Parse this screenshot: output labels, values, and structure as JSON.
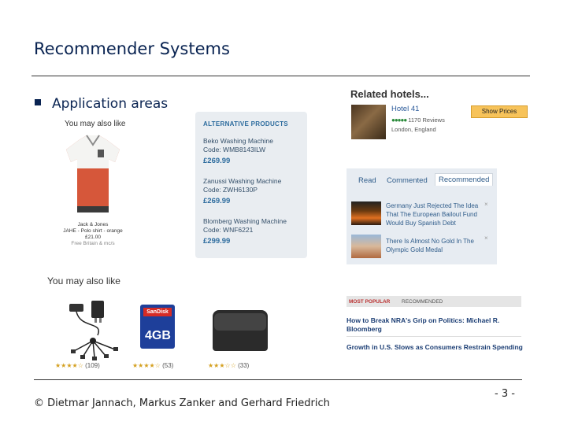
{
  "slide": {
    "title": "Recommender Systems",
    "bullet": "Application areas",
    "footer": "© Dietmar Jannach, Markus Zanker and Gerhard Friedrich",
    "page": "- 3 -"
  },
  "shop1": {
    "heading": "You may also like",
    "product_name": "Jack & Jones",
    "product_desc": "JAHE - Polo shirt - orange",
    "price": "£21.00",
    "shipping": "Free Britain & mc/s"
  },
  "alternative": {
    "heading": "ALTERNATIVE PRODUCTS",
    "items": [
      {
        "name": "Beko Washing Machine",
        "code": "Code: WMB8143ILW",
        "price": "£269.99"
      },
      {
        "name": "Zanussi Washing Machine",
        "code": "Code: ZWH6130P",
        "price": "£269.99"
      },
      {
        "name": "Blomberg Washing Machine",
        "code": "Code: WNF6221",
        "price": "£299.99"
      }
    ]
  },
  "hotels": {
    "heading": "Related hotels...",
    "name": "Hotel 41",
    "rating_dots": "●●●●●",
    "reviews": "1170 Reviews",
    "location": "London, England",
    "button": "Show Prices"
  },
  "news": {
    "tabs": [
      "Read",
      "Commented",
      "Recommended"
    ],
    "items": [
      "Germany Just Rejected The Idea That The European Bailout Fund Would Buy Spanish Debt",
      "There Is Almost No Gold In The Olympic Gold Medal"
    ],
    "close": "×"
  },
  "shop2": {
    "heading": "You may also like",
    "sd_brand": "SanDisk",
    "sd_capacity": "4GB",
    "products": [
      {
        "stars": "★★★★☆",
        "count": "(109)"
      },
      {
        "stars": "★★★★☆",
        "count": "(53)"
      },
      {
        "stars": "★★★☆☆",
        "count": "(33)"
      }
    ]
  },
  "popular": {
    "tabs": [
      "MOST POPULAR",
      "RECOMMENDED"
    ],
    "items": [
      "How to Break NRA's Grip on Politics: Michael R. Bloomberg",
      "Growth in U.S. Slows as Consumers Restrain Spending"
    ]
  }
}
